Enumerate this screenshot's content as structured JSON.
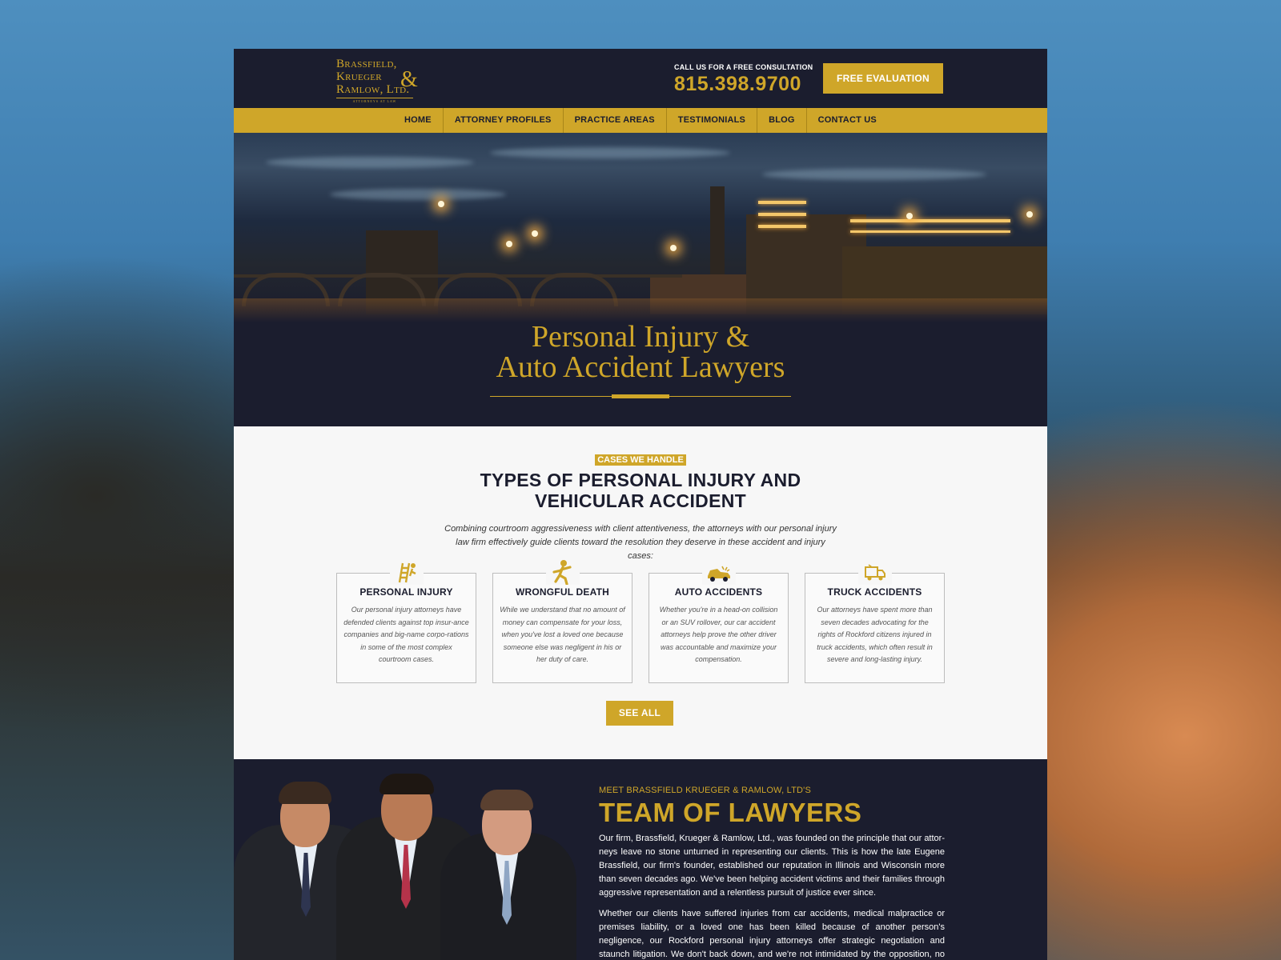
{
  "header": {
    "logo_lines": [
      "Brassfield,",
      "Krueger",
      "Ramlow, Ltd."
    ],
    "logo_ampersand": "&",
    "logo_sub": "ATTORNEYS AT LAW",
    "call_label": "CALL US FOR A FREE CONSULTATION",
    "phone": "815.398.9700",
    "cta_label": "FREE EVALUATION"
  },
  "nav": {
    "items": [
      "HOME",
      "ATTORNEY PROFILES",
      "PRACTICE AREAS",
      "TESTIMONIALS",
      "BLOG",
      "CONTACT US"
    ]
  },
  "hero": {
    "title_line1": "Personal Injury &",
    "title_line2": "Auto Accident Lawyers"
  },
  "cases": {
    "badge": "CASES WE HANDLE",
    "title_line1": "TYPES OF PERSONAL INJURY AND",
    "title_line2": "VEHICULAR ACCIDENT",
    "intro": "Combining courtroom aggressiveness with client attentiveness, the attorneys with our personal injury law firm effectively guide clients toward the resolution they deserve in these accident and injury cases:",
    "cards": [
      {
        "icon": "falling-ladder-icon",
        "title": "PERSONAL INJURY",
        "text": "Our personal injury attorneys have defended clients against top insur-ance companies and big-name corpo-rations in some of the most complex courtroom cases."
      },
      {
        "icon": "falling-person-icon",
        "title": "WRONGFUL DEATH",
        "text": "While we understand that no amount of money can compensate for your loss, when you've lost a loved one because someone else was negligent in his or her duty of care."
      },
      {
        "icon": "car-crash-icon",
        "title": "AUTO ACCIDENTS",
        "text": "Whether you're in a head-on collision or an SUV rollover, our car accident attorneys help prove the other driver was accountable and maximize your compensation."
      },
      {
        "icon": "truck-icon",
        "title": "TRUCK ACCIDENTS",
        "text": "Our attorneys have spent more than seven decades advocating for the rights of Rockford citizens injured in truck accidents, which often result in severe and long-lasting injury."
      }
    ],
    "see_all_label": "SEE ALL"
  },
  "team": {
    "kicker": "MEET BRASSFIELD KRUEGER & RAMLOW, LTD'S",
    "title": "TEAM OF LAWYERS",
    "paragraph1": "Our firm, Brassfield, Krueger & Ramlow, Ltd., was founded on the principle that our attor-neys leave no stone unturned in representing our clients. This is how the late Eugene Brassfield, our firm's founder, established our reputation in Illinois and Wisconsin more than seven decades ago. We've been helping accident victims and their families through aggressive representation and a relentless pursuit of justice ever since.",
    "paragraph2": "Whether our clients have suffered injuries from car accidents, medical malpractice or premises liability, or a loved one has been killed because of another person's negligence, our Rockford personal injury attorneys offer strategic negotiation and staunch litigation. We don't back down, and we're not intimidated by the opposition, no matter how big or"
  },
  "colors": {
    "navy": "#1b1d2e",
    "gold": "#cfa629",
    "light_bg": "#f7f7f7"
  }
}
